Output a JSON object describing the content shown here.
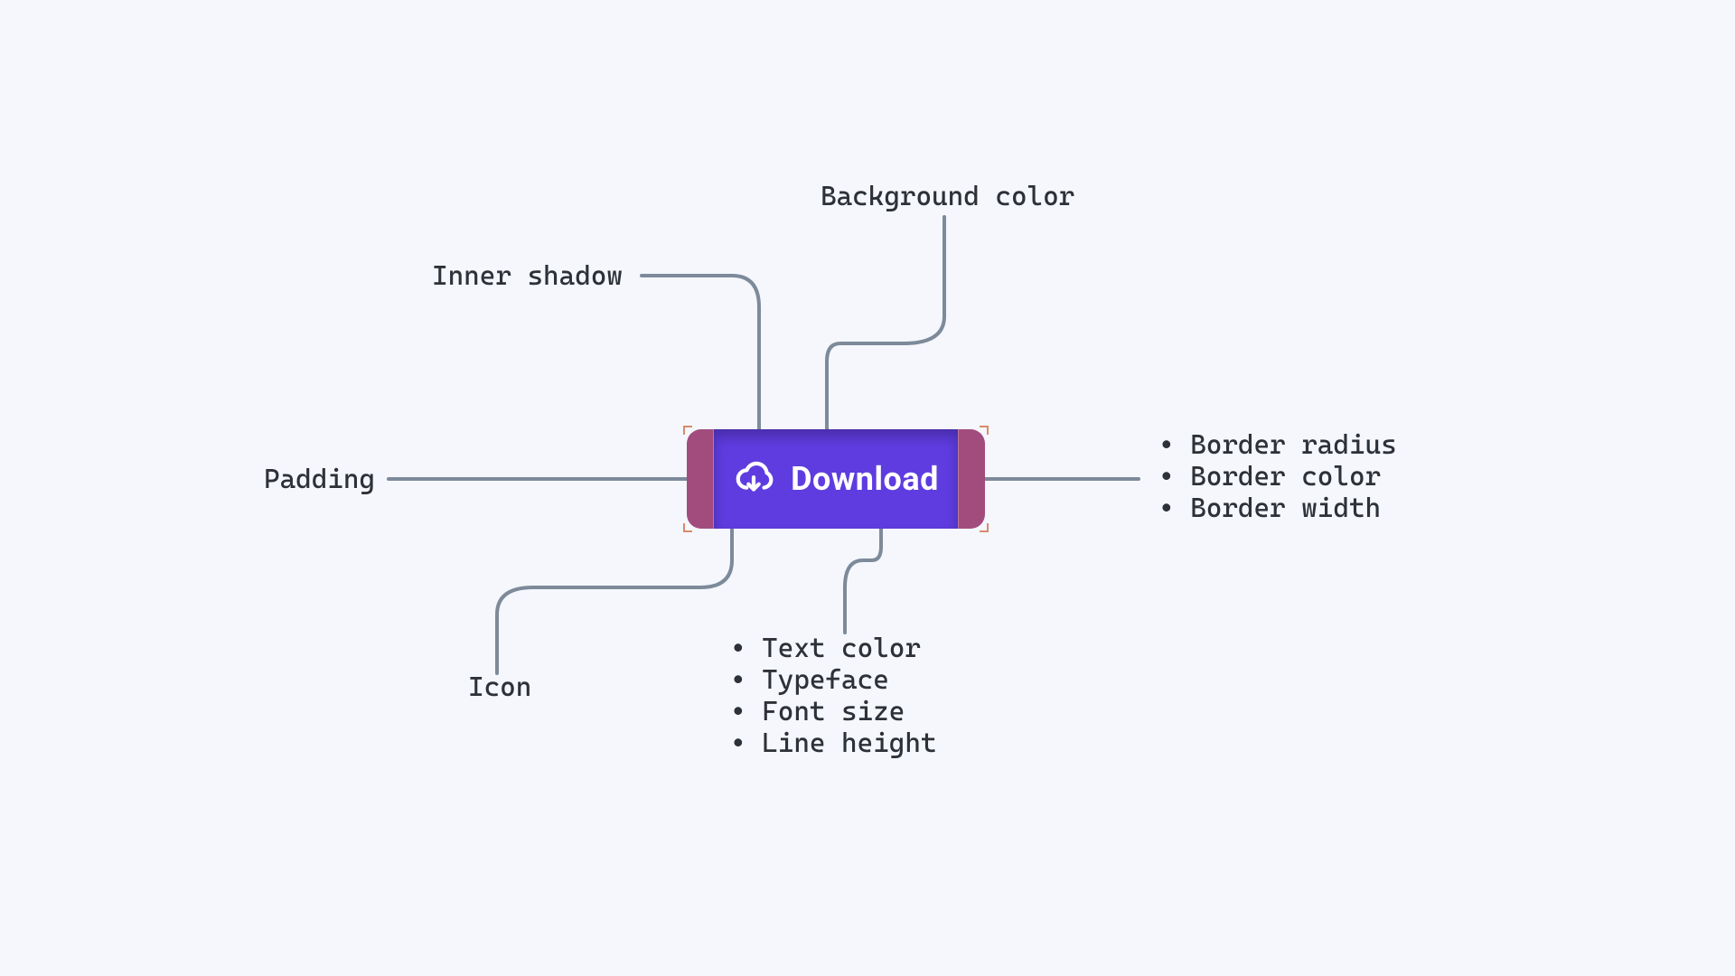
{
  "button": {
    "label": "Download",
    "icon": "download-cloud-icon"
  },
  "annotations": {
    "background_color": "Background color",
    "inner_shadow": "Inner shadow",
    "padding": "Padding",
    "icon": "Icon",
    "text_properties": [
      "Text color",
      "Typeface",
      "Font size",
      "Line height"
    ],
    "border_properties": [
      "Border radius",
      "Border color",
      "Border width"
    ]
  },
  "colors": {
    "button_bg": "#5f3ce0",
    "padding_overlay": "#a24c7d",
    "text": "#ffffff",
    "connector": "#7d8a9a",
    "page_bg": "#f5f7fc",
    "corner_tick": "#d98b6b"
  }
}
